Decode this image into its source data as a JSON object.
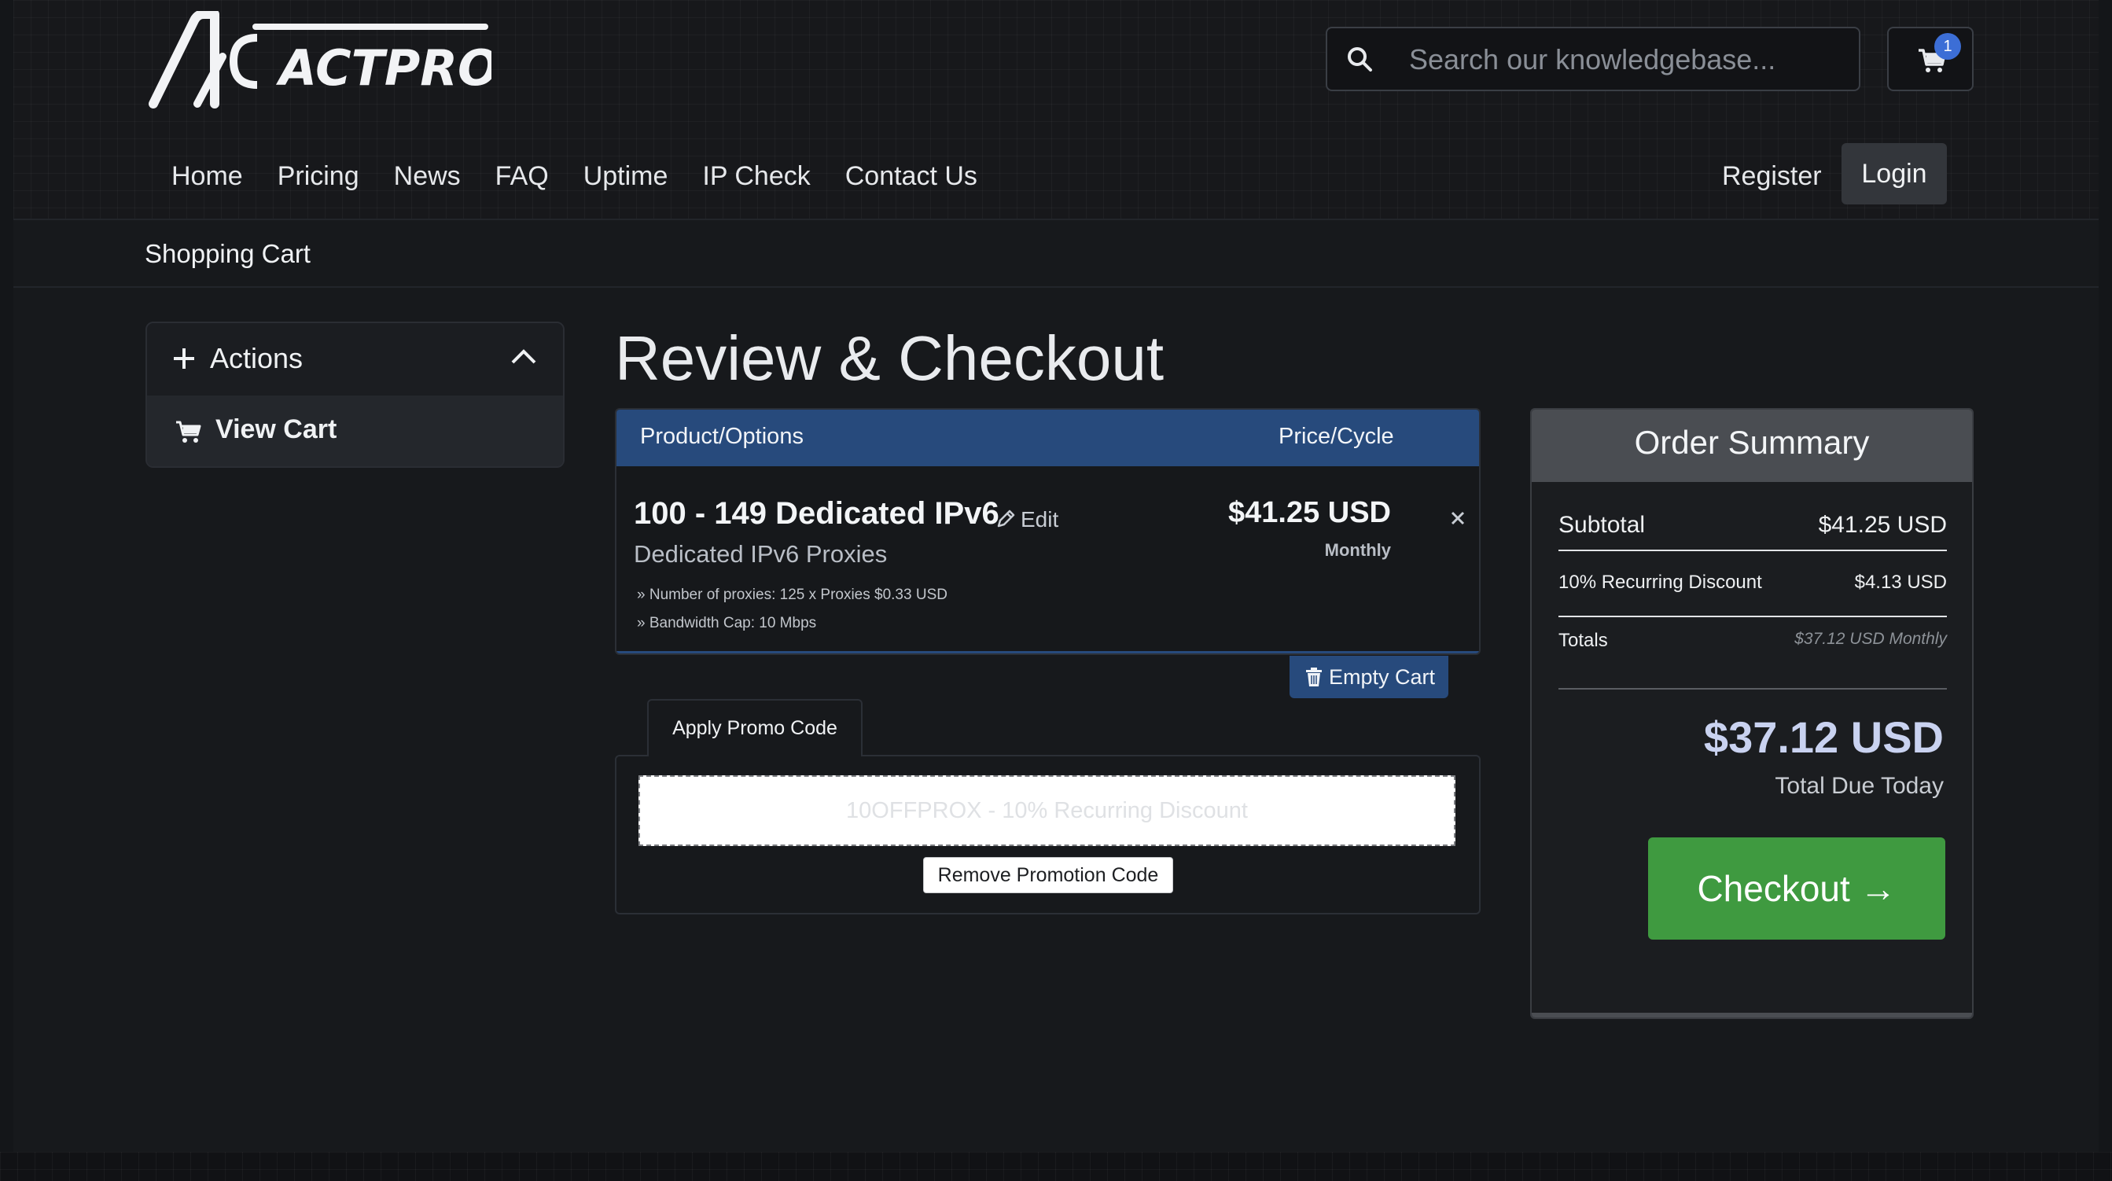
{
  "brand": {
    "logo_text": "ACTPROXY"
  },
  "header": {
    "search": {
      "placeholder": "Search our knowledgebase..."
    },
    "cart_count": "1",
    "nav": [
      "Home",
      "Pricing",
      "News",
      "FAQ",
      "Uptime",
      "IP Check",
      "Contact Us"
    ],
    "register_label": "Register",
    "login_label": "Login"
  },
  "breadcrumb": "Shopping Cart",
  "sidebar": {
    "actions_title": "Actions",
    "view_cart_label": "View Cart"
  },
  "main": {
    "title": "Review & Checkout",
    "table": {
      "col_product": "Product/Options",
      "col_price": "Price/Cycle"
    },
    "item": {
      "name": "100 - 149 Dedicated IPv6",
      "edit_label": "Edit",
      "group": "Dedicated IPv6 Proxies",
      "options": [
        "» Number of proxies: 125 x Proxies $0.33 USD",
        "» Bandwidth Cap: 10 Mbps"
      ],
      "price": "$41.25 USD",
      "cycle": "Monthly"
    },
    "empty_cart_label": "Empty Cart",
    "promo": {
      "tab_label": "Apply Promo Code",
      "applied_text": "10OFFPROX - 10% Recurring Discount",
      "remove_label": "Remove Promotion Code"
    }
  },
  "summary": {
    "title": "Order Summary",
    "subtotal_label": "Subtotal",
    "subtotal_value": "$41.25 USD",
    "discount_label": "10% Recurring Discount",
    "discount_value": "$4.13 USD",
    "totals_label": "Totals",
    "totals_value": "$37.12 USD Monthly",
    "total_due": "$37.12 USD",
    "total_due_label": "Total Due Today",
    "checkout_label": "Checkout →"
  },
  "colors": {
    "accent_blue": "#274a7c",
    "checkout_green": "#3f9a40",
    "badge_blue": "#3c6ed6"
  }
}
